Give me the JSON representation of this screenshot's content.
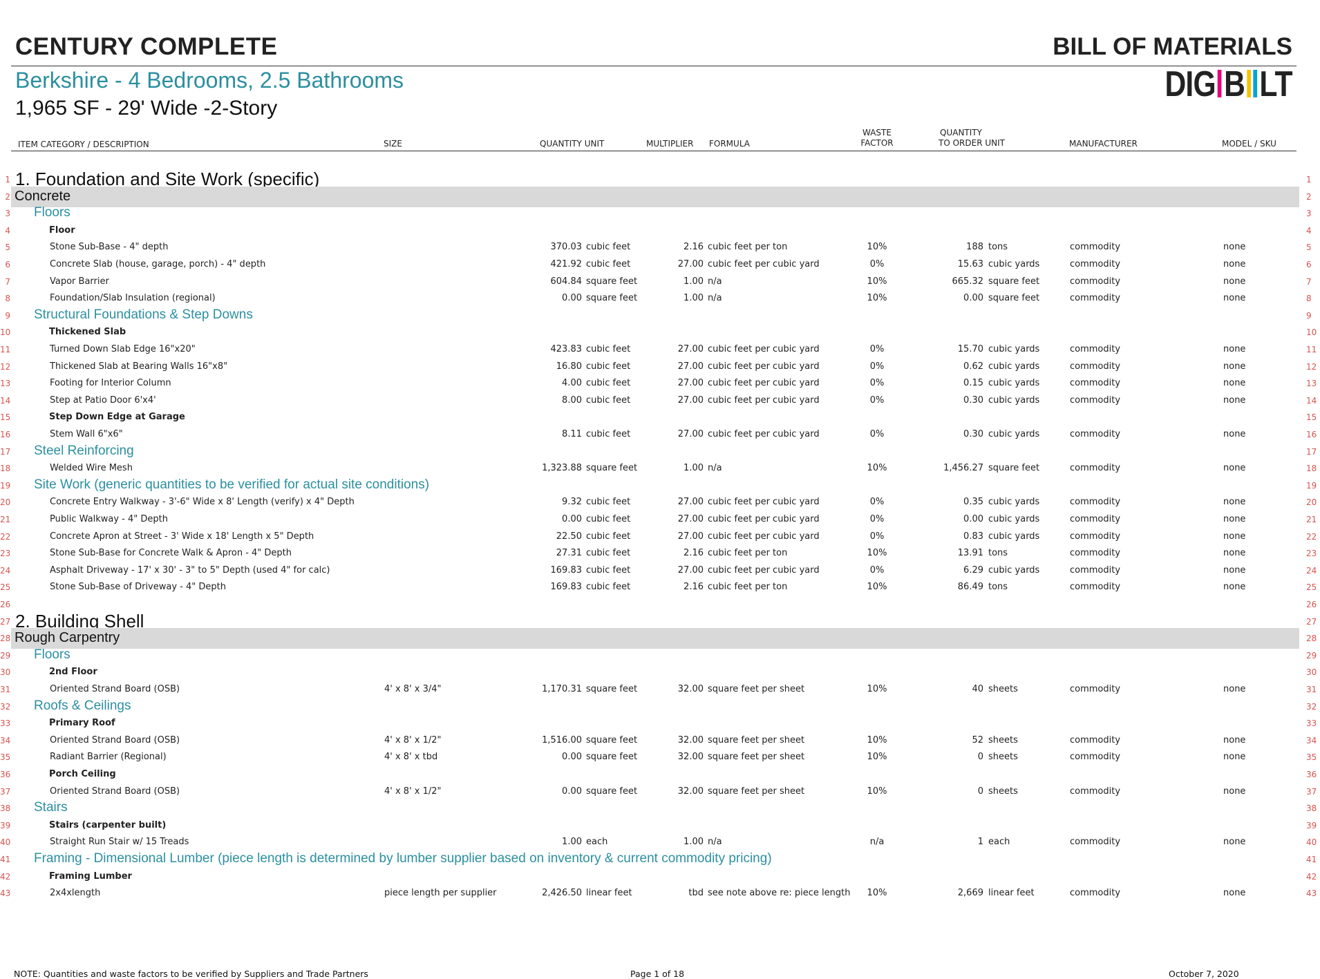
{
  "header": {
    "company": "CENTURY COMPLETE",
    "doc_type": "BILL OF MATERIALS",
    "plan": "Berkshire - 4 Bedrooms, 2.5 Bathrooms",
    "spec": "1,965 SF - 29' Wide -2-Story",
    "logo": {
      "l1": "DIG",
      "l2": "B",
      "l3": "LT",
      "colors": [
        "#e5007d",
        "#f4c400",
        "#00a6d6"
      ]
    }
  },
  "columns": {
    "item": "ITEM CATEGORY / DESCRIPTION",
    "size": "SIZE",
    "quantity_unit": "QUANTITY UNIT",
    "multiplier": "MULTIPLIER",
    "formula": "FORMULA",
    "waste_1": "WASTE",
    "waste_2": "FACTOR",
    "order_1": "QUANTITY",
    "order_2": "TO ORDER UNIT",
    "manufacturer": "MANUFACTURER",
    "model": "MODEL / SKU"
  },
  "rows": [
    {
      "n": "1",
      "type": "section",
      "text": "1. Foundation and Site Work (specific)"
    },
    {
      "n": "2",
      "type": "category",
      "text": "Concrete"
    },
    {
      "n": "3",
      "type": "subcategory",
      "text": "Floors"
    },
    {
      "n": "4",
      "type": "group",
      "text": "Floor"
    },
    {
      "n": "5",
      "type": "item",
      "desc": "Stone Sub-Base - 4\" depth",
      "size": "",
      "qty": "370.03",
      "unit": "cubic feet",
      "mult": "2.16",
      "formula": "cubic feet per ton",
      "waste": "10%",
      "oqty": "188",
      "ounit": "tons",
      "mfr": "commodity",
      "sku": "none"
    },
    {
      "n": "6",
      "type": "item",
      "desc": "Concrete Slab (house, garage, porch) - 4\" depth",
      "size": "",
      "qty": "421.92",
      "unit": "cubic feet",
      "mult": "27.00",
      "formula": "cubic feet per cubic yard",
      "waste": "0%",
      "oqty": "15.63",
      "ounit": "cubic yards",
      "mfr": "commodity",
      "sku": "none"
    },
    {
      "n": "7",
      "type": "item",
      "desc": "Vapor Barrier",
      "size": "",
      "qty": "604.84",
      "unit": "square feet",
      "mult": "1.00",
      "formula": "n/a",
      "waste": "10%",
      "oqty": "665.32",
      "ounit": "square feet",
      "mfr": "commodity",
      "sku": "none"
    },
    {
      "n": "8",
      "type": "item",
      "desc": "Foundation/Slab Insulation (regional)",
      "size": "",
      "qty": "0.00",
      "unit": "square feet",
      "mult": "1.00",
      "formula": "n/a",
      "waste": "10%",
      "oqty": "0.00",
      "ounit": "square feet",
      "mfr": "commodity",
      "sku": "none"
    },
    {
      "n": "9",
      "type": "subcategory",
      "text": "Structural Foundations & Step Downs"
    },
    {
      "n": "10",
      "type": "group",
      "text": "Thickened Slab"
    },
    {
      "n": "11",
      "type": "item",
      "desc": "Turned Down Slab Edge 16\"x20\"",
      "size": "",
      "qty": "423.83",
      "unit": "cubic feet",
      "mult": "27.00",
      "formula": "cubic feet per cubic yard",
      "waste": "0%",
      "oqty": "15.70",
      "ounit": "cubic yards",
      "mfr": "commodity",
      "sku": "none"
    },
    {
      "n": "12",
      "type": "item",
      "desc": "Thickened Slab at Bearing Walls 16\"x8\"",
      "size": "",
      "qty": "16.80",
      "unit": "cubic feet",
      "mult": "27.00",
      "formula": "cubic feet per cubic yard",
      "waste": "0%",
      "oqty": "0.62",
      "ounit": "cubic yards",
      "mfr": "commodity",
      "sku": "none"
    },
    {
      "n": "13",
      "type": "item",
      "desc": "Footing for Interior Column",
      "size": "",
      "qty": "4.00",
      "unit": "cubic feet",
      "mult": "27.00",
      "formula": "cubic feet per cubic yard",
      "waste": "0%",
      "oqty": "0.15",
      "ounit": "cubic yards",
      "mfr": "commodity",
      "sku": "none"
    },
    {
      "n": "14",
      "type": "item",
      "desc": "Step at Patio Door 6'x4'",
      "size": "",
      "qty": "8.00",
      "unit": "cubic feet",
      "mult": "27.00",
      "formula": "cubic feet per cubic yard",
      "waste": "0%",
      "oqty": "0.30",
      "ounit": "cubic yards",
      "mfr": "commodity",
      "sku": "none"
    },
    {
      "n": "15",
      "type": "group",
      "text": "Step Down Edge at Garage"
    },
    {
      "n": "16",
      "type": "item",
      "desc": "Stem Wall 6\"x6\"",
      "size": "",
      "qty": "8.11",
      "unit": "cubic feet",
      "mult": "27.00",
      "formula": "cubic feet per cubic yard",
      "waste": "0%",
      "oqty": "0.30",
      "ounit": "cubic yards",
      "mfr": "commodity",
      "sku": "none"
    },
    {
      "n": "17",
      "type": "subcategory",
      "text": "Steel Reinforcing"
    },
    {
      "n": "18",
      "type": "item",
      "desc": "Welded Wire Mesh",
      "size": "",
      "qty": "1,323.88",
      "unit": "square feet",
      "mult": "1.00",
      "formula": "n/a",
      "waste": "10%",
      "oqty": "1,456.27",
      "ounit": "square feet",
      "mfr": "commodity",
      "sku": "none"
    },
    {
      "n": "19",
      "type": "subcategory",
      "text": "Site Work (generic quantities to be verified for actual site conditions)"
    },
    {
      "n": "20",
      "type": "item",
      "desc": "Concrete Entry Walkway - 3'-6\" Wide x 8' Length (verify) x 4\" Depth",
      "size": "",
      "qty": "9.32",
      "unit": "cubic feet",
      "mult": "27.00",
      "formula": "cubic feet per cubic yard",
      "waste": "0%",
      "oqty": "0.35",
      "ounit": "cubic yards",
      "mfr": "commodity",
      "sku": "none"
    },
    {
      "n": "21",
      "type": "item",
      "desc": "Public Walkway - 4\" Depth",
      "size": "",
      "qty": "0.00",
      "unit": "cubic feet",
      "mult": "27.00",
      "formula": "cubic feet per cubic yard",
      "waste": "0%",
      "oqty": "0.00",
      "ounit": "cubic yards",
      "mfr": "commodity",
      "sku": "none"
    },
    {
      "n": "22",
      "type": "item",
      "desc": "Concrete Apron at Street - 3' Wide x 18' Length x 5\" Depth",
      "size": "",
      "qty": "22.50",
      "unit": "cubic feet",
      "mult": "27.00",
      "formula": "cubic feet per cubic yard",
      "waste": "0%",
      "oqty": "0.83",
      "ounit": "cubic yards",
      "mfr": "commodity",
      "sku": "none"
    },
    {
      "n": "23",
      "type": "item",
      "desc": "Stone Sub-Base for Concrete Walk & Apron - 4\" Depth",
      "size": "",
      "qty": "27.31",
      "unit": "cubic feet",
      "mult": "2.16",
      "formula": "cubic feet per ton",
      "waste": "10%",
      "oqty": "13.91",
      "ounit": "tons",
      "mfr": "commodity",
      "sku": "none"
    },
    {
      "n": "24",
      "type": "item",
      "desc": "Asphalt Driveway - 17' x 30' - 3\" to 5\" Depth (used 4\" for calc)",
      "size": "",
      "qty": "169.83",
      "unit": "cubic feet",
      "mult": "27.00",
      "formula": "cubic feet per cubic yard",
      "waste": "0%",
      "oqty": "6.29",
      "ounit": "cubic yards",
      "mfr": "commodity",
      "sku": "none"
    },
    {
      "n": "25",
      "type": "item",
      "desc": "Stone Sub-Base of Driveway - 4\" Depth",
      "size": "",
      "qty": "169.83",
      "unit": "cubic feet",
      "mult": "2.16",
      "formula": "cubic feet per ton",
      "waste": "10%",
      "oqty": "86.49",
      "ounit": "tons",
      "mfr": "commodity",
      "sku": "none"
    },
    {
      "n": "26",
      "type": "blank"
    },
    {
      "n": "27",
      "type": "section",
      "text": "2. Building Shell"
    },
    {
      "n": "28",
      "type": "category",
      "text": "Rough Carpentry"
    },
    {
      "n": "29",
      "type": "subcategory",
      "text": "Floors"
    },
    {
      "n": "30",
      "type": "group",
      "text": "2nd Floor"
    },
    {
      "n": "31",
      "type": "item",
      "desc": "Oriented Strand Board (OSB)",
      "size": "4' x 8' x 3/4\"",
      "qty": "1,170.31",
      "unit": "square feet",
      "mult": "32.00",
      "formula": "square feet per sheet",
      "waste": "10%",
      "oqty": "40",
      "ounit": "sheets",
      "mfr": "commodity",
      "sku": "none"
    },
    {
      "n": "32",
      "type": "subcategory",
      "text": "Roofs & Ceilings"
    },
    {
      "n": "33",
      "type": "group",
      "text": "Primary Roof"
    },
    {
      "n": "34",
      "type": "item",
      "desc": "Oriented Strand  Board (OSB)",
      "size": "4' x 8' x 1/2\"",
      "qty": "1,516.00",
      "unit": "square feet",
      "mult": "32.00",
      "formula": "square feet per sheet",
      "waste": "10%",
      "oqty": "52",
      "ounit": "sheets",
      "mfr": "commodity",
      "sku": "none"
    },
    {
      "n": "35",
      "type": "item",
      "desc": "Radiant Barrier (Regional)",
      "size": "4' x 8' x tbd",
      "qty": "0.00",
      "unit": "square feet",
      "mult": "32.00",
      "formula": "square feet per sheet",
      "waste": "10%",
      "oqty": "0",
      "ounit": "sheets",
      "mfr": "commodity",
      "sku": "none"
    },
    {
      "n": "36",
      "type": "group",
      "text": "Porch Ceiling"
    },
    {
      "n": "37",
      "type": "item",
      "desc": "Oriented Strand  Board (OSB)",
      "size": "4' x 8' x 1/2\"",
      "qty": "0.00",
      "unit": "square feet",
      "mult": "32.00",
      "formula": "square feet per sheet",
      "waste": "10%",
      "oqty": "0",
      "ounit": "sheets",
      "mfr": "commodity",
      "sku": "none"
    },
    {
      "n": "38",
      "type": "subcategory",
      "text": "Stairs"
    },
    {
      "n": "39",
      "type": "group",
      "text": "Stairs (carpenter built)"
    },
    {
      "n": "40",
      "type": "item",
      "desc": "Straight Run Stair w/ 15 Treads",
      "size": "",
      "qty": "1.00",
      "unit": "each",
      "mult": "1.00",
      "formula": "n/a",
      "waste": "n/a",
      "oqty": "1",
      "ounit": "each",
      "mfr": "commodity",
      "sku": "none"
    },
    {
      "n": "41",
      "type": "subcategory",
      "text": "Framing - Dimensional Lumber (piece length is determined by lumber supplier based on inventory & current commodity pricing)"
    },
    {
      "n": "42",
      "type": "group",
      "text": "Framing Lumber"
    },
    {
      "n": "43",
      "type": "item",
      "desc": "2x4xlength",
      "size": "piece length per supplier",
      "qty": "2,426.50",
      "unit": "linear feet",
      "mult": "tbd",
      "formula": "see note above re: piece length",
      "waste": "10%",
      "oqty": "2,669",
      "ounit": "linear feet",
      "mfr": "commodity",
      "sku": "none"
    }
  ],
  "footer": {
    "note": "NOTE: Quantities and waste factors to be verified by Suppliers and Trade Partners",
    "page": "Page 1 of 18",
    "date": "October 7, 2020"
  }
}
